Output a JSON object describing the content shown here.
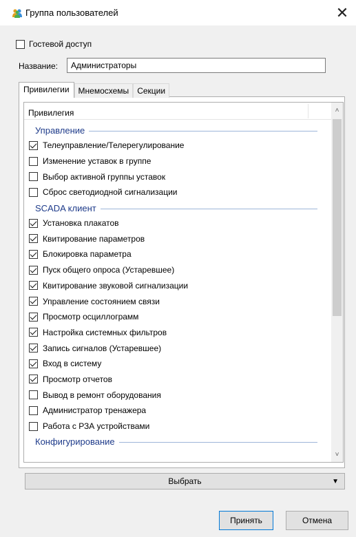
{
  "window": {
    "title": "Группа пользователей",
    "icon": "users-icon",
    "close_glyph": "✕"
  },
  "guest_access": {
    "label": "Гостевой доступ",
    "checked": false
  },
  "name_field": {
    "label": "Название:",
    "value": "Администраторы"
  },
  "tabs": [
    {
      "label": "Привилегии",
      "active": true
    },
    {
      "label": "Мнемосхемы",
      "active": false
    },
    {
      "label": "Секции",
      "active": false
    }
  ],
  "privileges": {
    "column_header": "Привилегия",
    "groups": [
      {
        "title": "Управление",
        "items": [
          {
            "label": "Телеуправление/Телерегулирование",
            "checked": true
          },
          {
            "label": "Изменение уставок в группе",
            "checked": false
          },
          {
            "label": "Выбор активной группы уставок",
            "checked": false
          },
          {
            "label": "Сброс светодиодной сигнализации",
            "checked": false
          }
        ]
      },
      {
        "title": "SCADA клиент",
        "items": [
          {
            "label": "Установка плакатов",
            "checked": true
          },
          {
            "label": "Квитирование параметров",
            "checked": true
          },
          {
            "label": "Блокировка параметра",
            "checked": true
          },
          {
            "label": "Пуск общего опроса (Устаревшее)",
            "checked": true
          },
          {
            "label": "Квитирование звуковой сигнализации",
            "checked": true
          },
          {
            "label": "Управление состоянием связи",
            "checked": true
          },
          {
            "label": "Просмотр осциллограмм",
            "checked": true
          },
          {
            "label": "Настройка системных фильтров",
            "checked": true
          },
          {
            "label": "Запись сигналов (Устаревшее)",
            "checked": true
          },
          {
            "label": "Вход в систему",
            "checked": true
          },
          {
            "label": "Просмотр отчетов",
            "checked": true
          },
          {
            "label": "Вывод в ремонт оборудования",
            "checked": false
          },
          {
            "label": "Администратор тренажера",
            "checked": false
          },
          {
            "label": "Работа с РЗА устройствами",
            "checked": false
          }
        ]
      },
      {
        "title": "Конфигурирование",
        "items": []
      }
    ]
  },
  "select_button": {
    "label": "Выбрать",
    "dropdown_glyph": "▼"
  },
  "buttons": {
    "accept": "Принять",
    "cancel": "Отмена"
  },
  "scrollbar": {
    "up_glyph": "˄",
    "down_glyph": "˅"
  },
  "colors": {
    "group_title": "#1e3b8a",
    "group_line": "#9db5d9",
    "accent_border": "#0078d7"
  }
}
